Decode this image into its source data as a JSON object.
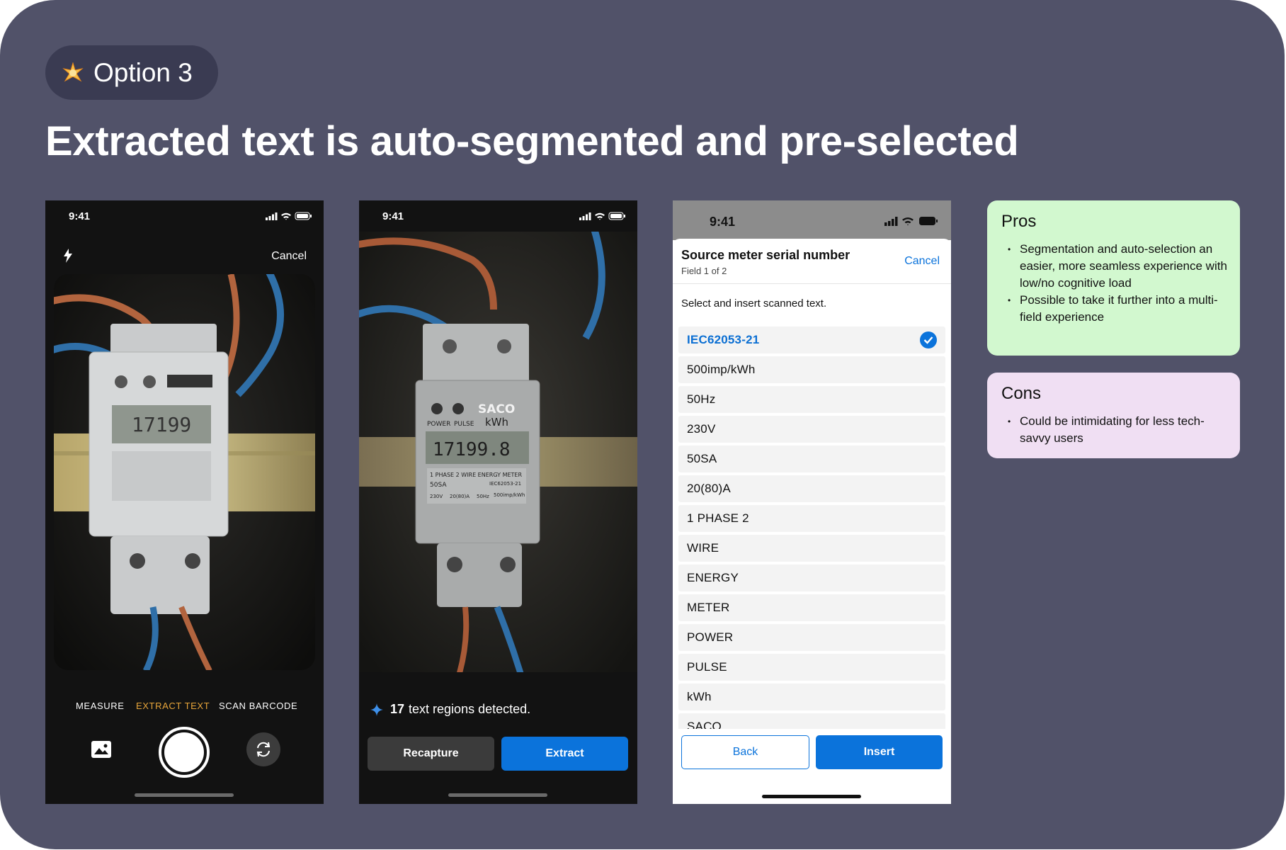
{
  "badge": {
    "label": "Option 3",
    "icon": "sparkle-icon"
  },
  "headline": "Extracted text is auto-segmented and pre-selected",
  "phone1": {
    "time": "9:41",
    "cancel_label": "Cancel",
    "modes": [
      "MEASURE",
      "EXTRACT TEXT",
      "SCAN BARCODE"
    ],
    "active_mode": "EXTRACT TEXT"
  },
  "phone2": {
    "time": "9:41",
    "detected_count": "17",
    "detected_text": "text regions detected.",
    "recapture_label": "Recapture",
    "extract_label": "Extract"
  },
  "phone3": {
    "time": "9:41",
    "sheet_title": "Source meter serial number",
    "sheet_subtitle": "Field 1 of 2",
    "cancel_label": "Cancel",
    "instruction": "Select and insert scanned text.",
    "items": [
      "IEC62053-21",
      "500imp/kWh",
      "50Hz",
      "230V",
      "50SA",
      "20(80)A",
      "1 PHASE 2",
      "WIRE",
      "ENERGY",
      "METER",
      "POWER",
      "PULSE",
      "kWh",
      "SACO"
    ],
    "selected_item": "IEC62053-21",
    "back_label": "Back",
    "insert_label": "Insert"
  },
  "pros": {
    "title": "Pros",
    "points": [
      "Segmentation and auto-selection an easier, more seamless experience with low/no cognitive load",
      "Possible to take it further into a multi-field experience"
    ]
  },
  "cons": {
    "title": "Cons",
    "points": [
      "Could be intimidating for less tech-savvy users"
    ]
  },
  "meter_photo": {
    "brand": "SACO",
    "unit": "kWh",
    "display": "17199.8",
    "labels": [
      "POWER",
      "PULSE",
      "1 PHASE 2 WIRE ENERGY METER",
      "50SA",
      "IEC62053-21",
      "230V",
      "20(80)A",
      "50Hz",
      "500imp/kWh"
    ]
  },
  "colors": {
    "board": "#515269",
    "accent": "#0b73db",
    "mode_active": "#e8a53a",
    "pros": "#d2f8cf",
    "cons": "#f0dff3"
  }
}
